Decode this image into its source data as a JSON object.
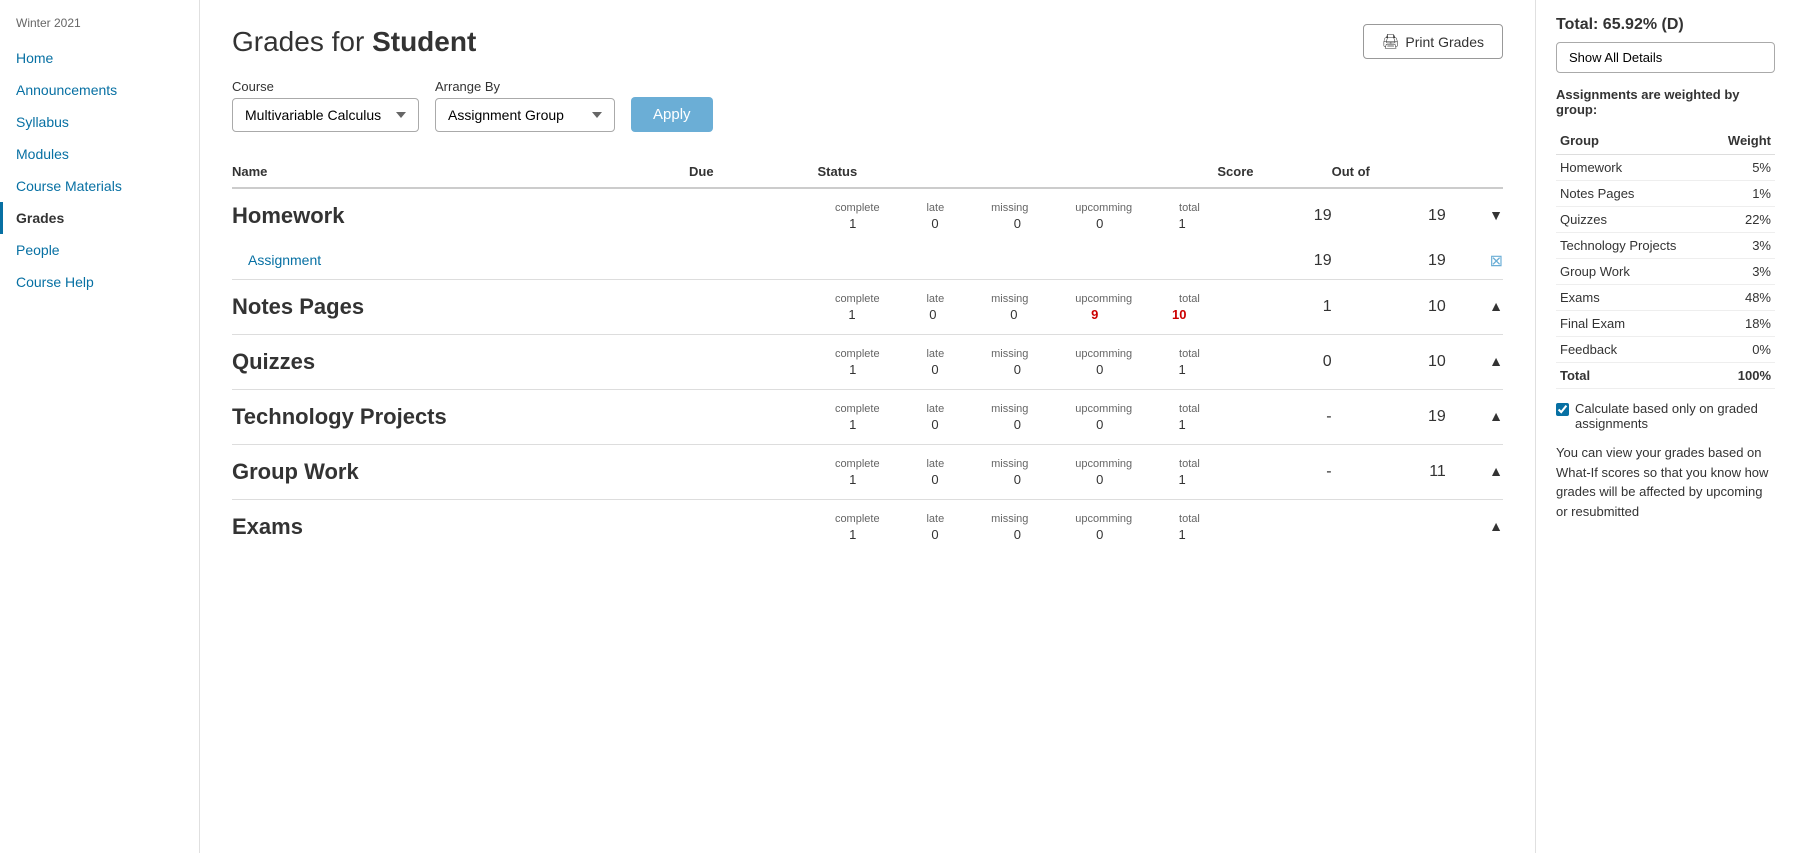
{
  "sidebar": {
    "season": "Winter 2021",
    "nav_items": [
      {
        "id": "home",
        "label": "Home",
        "active": false
      },
      {
        "id": "announcements",
        "label": "Announcements",
        "active": false
      },
      {
        "id": "syllabus",
        "label": "Syllabus",
        "active": false
      },
      {
        "id": "modules",
        "label": "Modules",
        "active": false
      },
      {
        "id": "course-materials",
        "label": "Course Materials",
        "active": false
      },
      {
        "id": "grades",
        "label": "Grades",
        "active": true
      },
      {
        "id": "people",
        "label": "People",
        "active": false
      },
      {
        "id": "course-help",
        "label": "Course Help",
        "active": false
      }
    ]
  },
  "header": {
    "title_prefix": "Grades for ",
    "title_bold": "Student",
    "print_btn": "Print Grades"
  },
  "filters": {
    "course_label": "Course",
    "course_value": "Multivariable Calculus",
    "arrange_label": "Arrange By",
    "arrange_value": "Assignment Group",
    "apply_label": "Apply"
  },
  "table": {
    "col_name": "Name",
    "col_due": "Due",
    "col_status": "Status",
    "col_score": "Score",
    "col_outof": "Out of",
    "status_headers": [
      "complete",
      "late",
      "missing",
      "upcomming",
      "total"
    ],
    "groups": [
      {
        "id": "homework",
        "name": "Homework",
        "status": [
          1,
          0,
          0,
          0,
          1
        ],
        "score": "19",
        "outof": "19",
        "collapsed": true,
        "assignments": [
          {
            "name": "Assignment",
            "due": "",
            "score": "19",
            "outof": "19",
            "status_icon": "submit"
          }
        ]
      },
      {
        "id": "notes-pages",
        "name": "Notes Pages",
        "status": [
          1,
          0,
          0,
          9,
          10
        ],
        "score": "1",
        "outof": "10",
        "collapsed": false,
        "assignments": []
      },
      {
        "id": "quizzes",
        "name": "Quizzes",
        "status": [
          1,
          0,
          0,
          0,
          1
        ],
        "score": "0",
        "outof": "10",
        "collapsed": false,
        "assignments": []
      },
      {
        "id": "technology-projects",
        "name": "Technology Projects",
        "status": [
          1,
          0,
          0,
          0,
          1
        ],
        "score": "-",
        "outof": "19",
        "collapsed": false,
        "assignments": []
      },
      {
        "id": "group-work",
        "name": "Group Work",
        "status": [
          1,
          0,
          0,
          0,
          1
        ],
        "score": "-",
        "outof": "11",
        "collapsed": false,
        "assignments": []
      },
      {
        "id": "exams",
        "name": "Exams",
        "status": [
          1,
          0,
          0,
          0,
          1
        ],
        "score": "",
        "outof": "",
        "collapsed": false,
        "assignments": []
      }
    ]
  },
  "right_panel": {
    "total_label": "Total: 65.92% (D)",
    "show_all_btn": "Show All Details",
    "weighted_note": "Assignments are weighted by group:",
    "weight_col_group": "Group",
    "weight_col_weight": "Weight",
    "weights": [
      {
        "group": "Homework",
        "weight": "5%"
      },
      {
        "group": "Notes Pages",
        "weight": "1%"
      },
      {
        "group": "Quizzes",
        "weight": "22%"
      },
      {
        "group": "Technology Projects",
        "weight": "3%"
      },
      {
        "group": "Group Work",
        "weight": "3%"
      },
      {
        "group": "Exams",
        "weight": "48%"
      },
      {
        "group": "Final Exam",
        "weight": "18%"
      },
      {
        "group": "Feedback",
        "weight": "0%"
      },
      {
        "group": "Total",
        "weight": "100%"
      }
    ],
    "checkbox_label": "Calculate based only on graded assignments",
    "what_if_text": "You can view your grades based on What-If scores so that you know how grades will be affected by upcoming or resubmitted"
  }
}
